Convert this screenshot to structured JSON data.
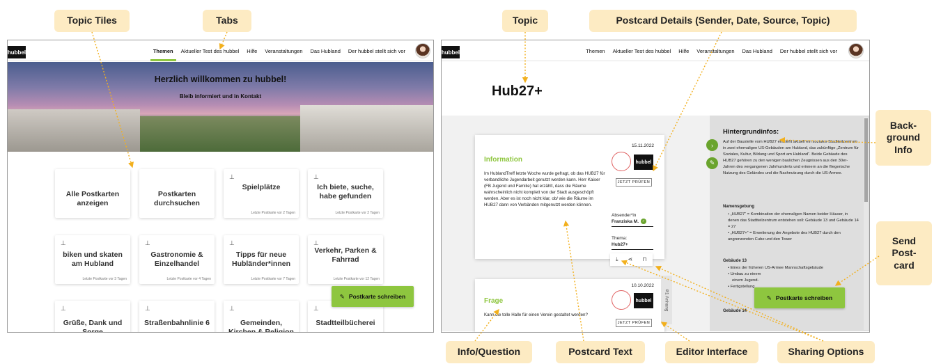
{
  "callouts": {
    "topic_tiles": "Topic Tiles",
    "tabs": "Tabs",
    "topic": "Topic",
    "postcard_details": "Postcard Details (Sender, Date, Source, Topic)",
    "background_info": "Back-\nground\nInfo",
    "send_postcard": "Send\nPost-\ncard",
    "info_question": "Info/Question",
    "postcard_text": "Postcard Text",
    "editor_interface": "Editor Interface",
    "sharing_options": "Sharing Options"
  },
  "brand": {
    "logo": "hubbel",
    "accent": "#8ec63f"
  },
  "nav": {
    "items": [
      "Themen",
      "Aktueller Test des hubbel",
      "Hilfe",
      "Veranstaltungen",
      "Das Hubland",
      "Der hubbel stellt sich vor"
    ],
    "active": "Themen"
  },
  "hero": {
    "title": "Herzlich willkommen zu hubbel!",
    "subtitle": "Bleib informiert und in Kontakt"
  },
  "tiles": [
    {
      "title": "Alle Postkarten anzeigen",
      "meta": ""
    },
    {
      "title": "Postkarten durchsuchen",
      "meta": ""
    },
    {
      "title": "Spielplätze",
      "meta": "Letzte Postkarte vor 2 Tagen"
    },
    {
      "title": "Ich biete, suche, habe gefunden",
      "meta": "Letzte Postkarte vor 2 Tagen"
    },
    {
      "title": "biken und skaten am Hubland",
      "meta": "Letzte Postkarte vor 3 Tagen"
    },
    {
      "title": "Gastronomie & Einzelhandel",
      "meta": "Letzte Postkarte vor 4 Tagen"
    },
    {
      "title": "Tipps für neue Hubländer*innen",
      "meta": "Letzte Postkarte vor 7 Tagen"
    },
    {
      "title": "Verkehr, Parken & Fahrrad",
      "meta": "Letzte Postkarte vor 12 Tagen"
    },
    {
      "title": "Grüße, Dank und Sorge",
      "meta": ""
    },
    {
      "title": "Straßenbahnlinie 6",
      "meta": ""
    },
    {
      "title": "Gemeinden, Kirchen & Religion",
      "meta": ""
    },
    {
      "title": "Stadtteilbücherei",
      "meta": ""
    }
  ],
  "write_button": "Postkarte schreiben",
  "topic_page": {
    "title": "Hub27+",
    "card1": {
      "label": "Information",
      "date": "15.11.2022",
      "text": "Im HublandTreff letzte Woche wurde gefragt, ob das HUB27 für verbandliche Jugendarbeit genutzt werden kann. Herr Kaiser (FB Jugend und Familie) hat erzählt, dass die Räume wahrscheinlich nicht komplett von der Stadt ausgeschöpft werden. Aber es ist noch nicht klar, ob/ wie die Räume im HUB27 dann von Verbänden mitgenutzt werden können.",
      "check": "JETZT PRÜFEN",
      "sender_label": "Absender*in",
      "sender": "Franziska M.",
      "topic_label": "Thema:",
      "topic": "Hub27+"
    },
    "card2": {
      "label": "Frage",
      "date": "10.10.2022",
      "text": "Kann die tolle Halle für einen Verein gestaltet werden?",
      "check": "JETZT PRÜFEN",
      "attachment": "1 Anhang"
    },
    "background": {
      "title": "Hintergrundinfos:",
      "intro": "Auf der Baustelle vom HUB27 entsteht aktuell ein soziales Stadtteilzentrum in zwei ehemaligen US-Gebäuden am Hubland, das zukünftige „Zentrum für Soziales, Kultur, Bildung und Sport am Hubland“. Beide Gebäude des HUB27 gehören zu den wenigen baulichen Zeugnissen aus den 30er-Jahren des vergangenen Jahrhunderts und erinnern an die fliegerische Nutzung des Geländes und die Nachnutzung durch die US-Armee.",
      "naming_title": "Namensgebung",
      "naming_1": "„HUB27“ = Kombination der ehemaligen Namen beider Häuser, in denen das Stadtteilzentrum entstehen soll: Gebäude 13 und Gebäude 14 = 27",
      "naming_2": "„HUB27+“ = Erweiterung der Angebote des HUB27 durch den angrenzenden Cube und den Tower",
      "b13_title": "Gebäude 13",
      "b13_1": "Eines der früheren US-Armee Mannschaftsgebäude",
      "b13_2": "Umbau zu einem",
      "b13_3": "einem Jugend-",
      "b13_4": "Fertigstellung",
      "b14_title": "Gebäude 14"
    }
  }
}
